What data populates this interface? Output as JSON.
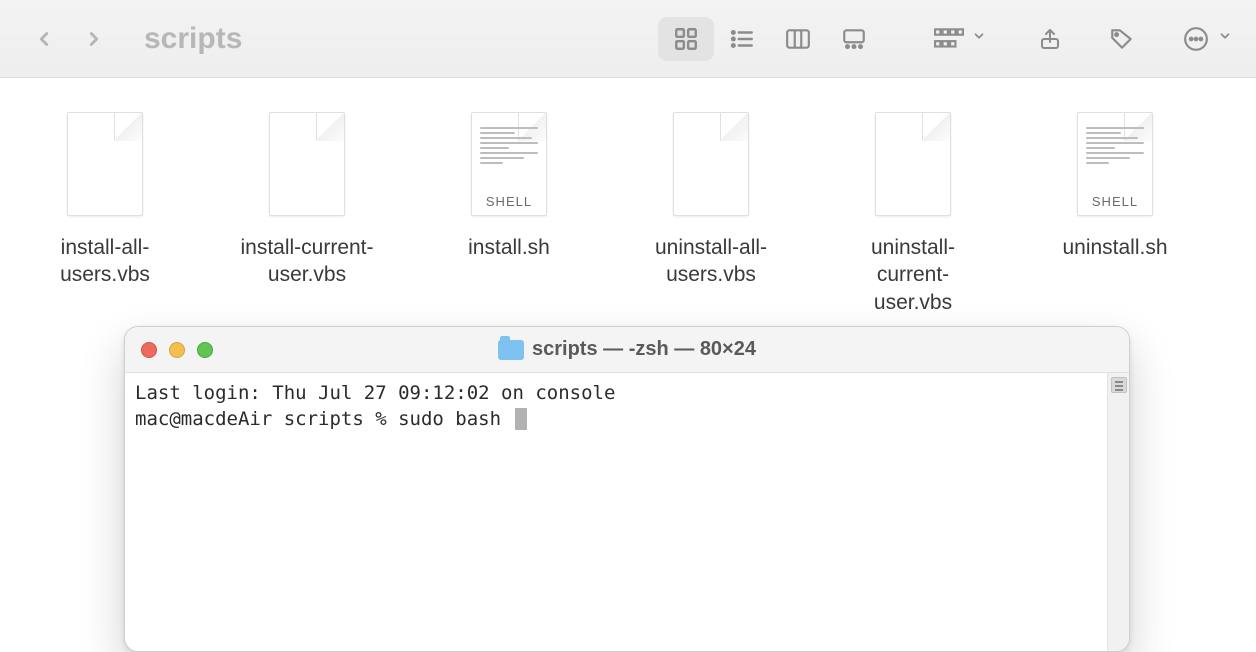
{
  "finder": {
    "title": "scripts",
    "files": [
      {
        "name": "install-all-users.vbs",
        "kind": "generic"
      },
      {
        "name": "install-current-user.vbs",
        "kind": "generic"
      },
      {
        "name": "install.sh",
        "kind": "shell",
        "badge": "SHELL"
      },
      {
        "name": "uninstall-all-users.vbs",
        "kind": "generic"
      },
      {
        "name": "uninstall-current-user.vbs",
        "kind": "generic"
      },
      {
        "name": "uninstall.sh",
        "kind": "shell",
        "badge": "SHELL"
      }
    ]
  },
  "terminal": {
    "title": "scripts — -zsh — 80×24",
    "lines": [
      "Last login: Thu Jul 27 09:12:02 on console",
      "mac@macdeAir scripts % sudo bash "
    ]
  }
}
